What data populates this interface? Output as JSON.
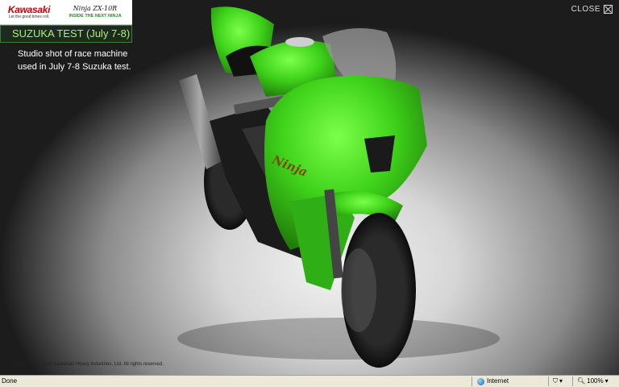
{
  "header": {
    "brand_name": "Kawasaki",
    "brand_tagline": "Let the good times roll.",
    "model_name": "Ninja ZX-10R",
    "model_tagline": "INSIDE THE NEXT NINJA"
  },
  "gallery": {
    "title": "SUZUKA TEST (July 7-8)",
    "description_line1": "Studio shot of race machine",
    "description_line2": "used in July 7-8 Suzuka test.",
    "close_label": "CLOSE",
    "fairing_logo": "Ninja",
    "copyright": "Copyright (C) 2010 Kawasaki Heavy Industries, Ltd. All rights reserved."
  },
  "statusbar": {
    "status": "Done",
    "zone": "Internet",
    "zoom": "100%"
  },
  "colors": {
    "bike_green": "#3fd21a",
    "title_text": "#a6f07a",
    "kawasaki_red": "#cc0000"
  }
}
